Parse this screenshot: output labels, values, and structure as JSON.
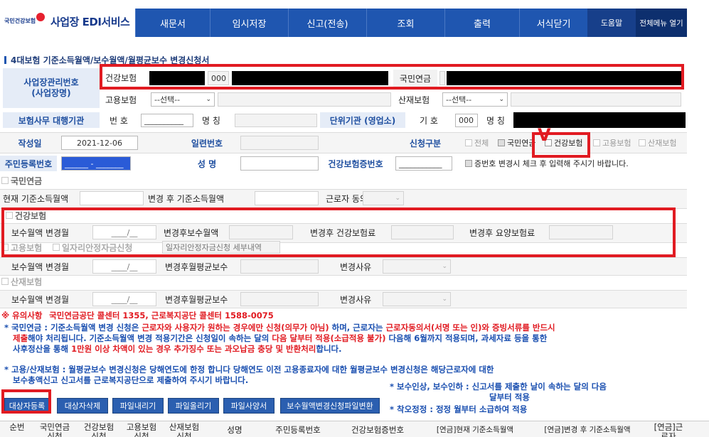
{
  "header": {
    "logo_text": "국민건강보험",
    "app_title": "사업장 EDI서비스",
    "menu": [
      "새문서",
      "임시저장",
      "신고(전송)",
      "조회",
      "출력",
      "서식닫기"
    ],
    "help": "도움말",
    "all_menu": "전체메뉴 열기"
  },
  "page_title": "4대보험 기준소득월액/보수월액/월평균보수 변경신청서",
  "workplace": {
    "label": "사업장관리번호\n(사업장명)",
    "health_label": "건강보험",
    "health_code": "000",
    "pension_label": "국민연금",
    "employment_label": "고용보험",
    "employment_select": "--선택--",
    "industrial_label": "산재보험",
    "industrial_select": "--선택--"
  },
  "agency": {
    "label": "보험사무 대행기관",
    "number_label": "번 호",
    "number_value": "__________",
    "name_label": "명 칭",
    "unit_label": "단위기관 (영업소)",
    "unit_code_label": "기 호",
    "unit_code": "000",
    "unit_name_label": "명 칭"
  },
  "form": {
    "date_label": "작성일",
    "date_value": "2021-12-06",
    "serial_label": "일련번호",
    "request_type_label": "신청구분",
    "options": [
      "전체",
      "국민연금",
      "건강보험",
      "고용보험",
      "산재보험"
    ],
    "rrn_label": "주민등록번호",
    "rrn_value": "______ - _______",
    "name_label": "성 명",
    "health_no_label": "건강보험증번호",
    "health_no_value": "___________",
    "check_note": "증번호 변경시 체크 후 입력해 주시기 바랍니다."
  },
  "pension": {
    "section": "국민연금",
    "current_label": "현재 기준소득월액",
    "after_label": "변경 후 기준소득월액",
    "consent_label": "근로자 동의"
  },
  "health": {
    "section": "건강보험",
    "month_label": "보수월액 변경월",
    "month_value": "____/__",
    "after_pay_label": "변경후보수월액",
    "after_premium_label": "변경후 건강보험료",
    "after_care_label": "변경후 요양보험료"
  },
  "employment": {
    "section": "고용보험",
    "subsidy_label": "일자리안정자금신청",
    "subsidy_detail": "일자리안정자금신청 세부내역",
    "month_label": "보수월액 변경월",
    "month_value": "____/__",
    "after_avg_label": "변경후월평균보수",
    "reason_label": "변경사유"
  },
  "industrial": {
    "section": "산재보험",
    "month_label": "보수월액 변경월",
    "month_value": "____/__",
    "after_avg_label": "변경후월평균보수",
    "reason_label": "변경사유"
  },
  "notices": {
    "line1_prefix": "※ 유의사항",
    "line1_red": "국민연금공단 콜센터 1355, 근로복지공단 콜센터 1588-0075",
    "line2a": "* 국민연금 : 기준소득월액 변경 신청은 ",
    "line2b": "근로자와 사용자가 원하는 경우에만 신청(의무가 아님)",
    "line2c": " 하며, 근로자는 ",
    "line2d": "근로자동의서(서명 또는 인)와 증빙서류를 반드시",
    "line3a": "제출",
    "line3b": "해야 처리됩니다. 기준소득월액 변경 적용기간은 신청일이 속하는 달의 ",
    "line3c": "다음 달부터 적용(소급적용 불가)",
    "line3d": " 다음해 6월까지 적용되며, 과세자료 등을 통한",
    "line4a": "사후정산을 통해 ",
    "line4b": "1만원 이상 차액이 있는 경우 추가징수 또는 과오납금 충당 및 반환처리",
    "line4c": "합니다.",
    "line5": "* 고용/산재보험 : 월평균보수 변경신청은 당해연도에 한정 합니다 당해연도 이전 고용종료자에 대한 월평균보수 변경신청은 해당근로자에 대한",
    "line6": "보수총액신고 신고서를 근로복지공단으로 제출하여 주시기 바랍니다.",
    "line7": "* 보수인상, 보수인하 : 신고서를 제출한 날이 속하는 달의 다음",
    "line7b": "달부터 적용",
    "line8": "* 착오정정 : 정정 월부터 소급하여 적용"
  },
  "buttons": [
    "대상자등록",
    "대상자삭제",
    "파일내리기",
    "파일올리기",
    "파일사양서",
    "보수월액변경신청파일변환"
  ],
  "table_header": {
    "cols": [
      "순번",
      "국민연금\n신청",
      "건강보험\n신청",
      "고용보험\n신청",
      "산재보험\n신청",
      "성명",
      "주민등록번호",
      "건강보험증번호",
      "[연금]현재 기준소득월액",
      "[연금]변경 후 기준소득월액",
      "[연금]근\n로자"
    ]
  }
}
